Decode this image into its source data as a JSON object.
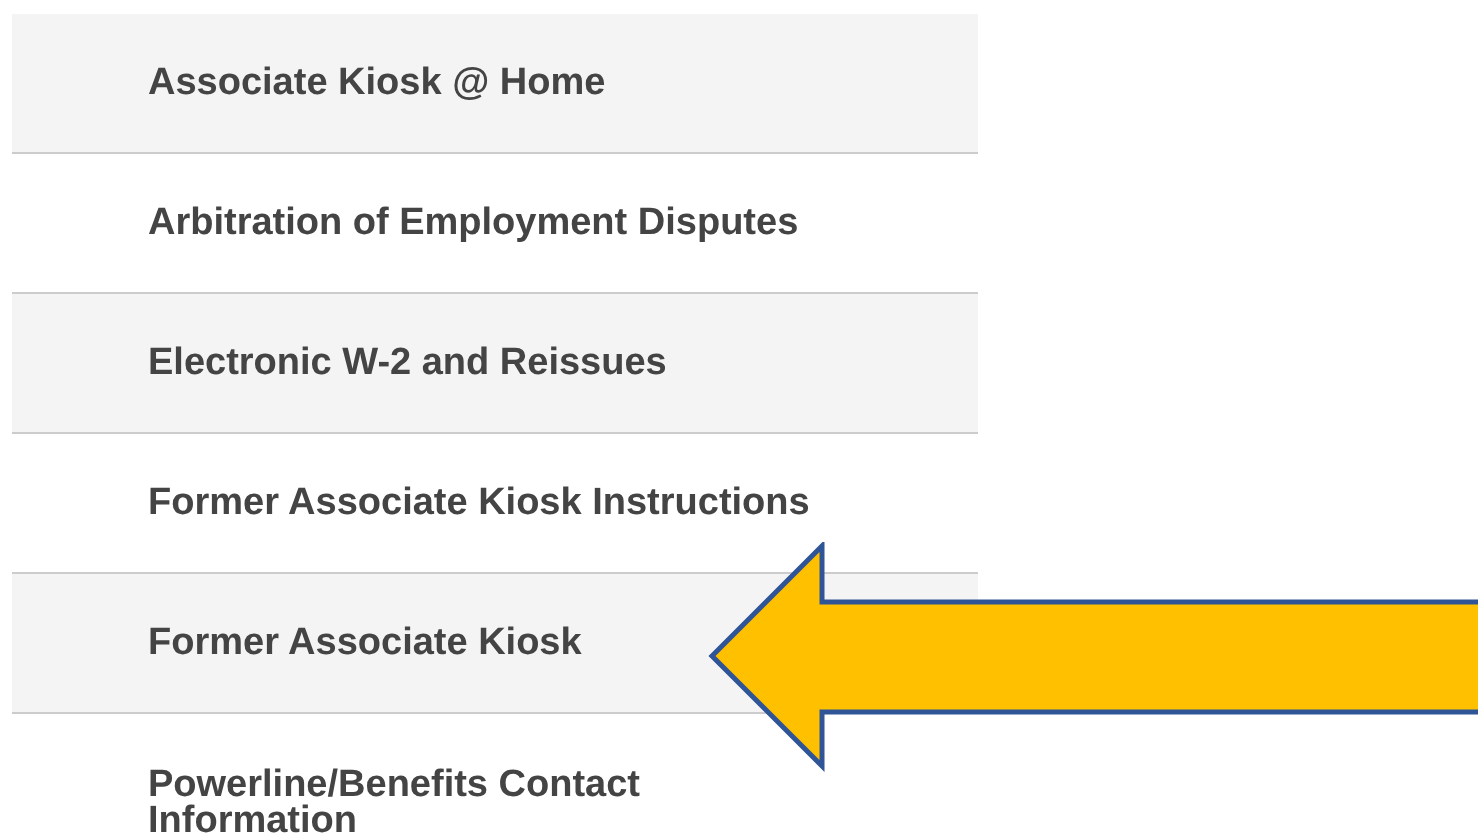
{
  "menu": {
    "items": [
      {
        "label": "Associate Kiosk @ Home"
      },
      {
        "label": "Arbitration of Employment Disputes"
      },
      {
        "label": "Electronic W-2 and Reissues"
      },
      {
        "label": "Former Associate Kiosk Instructions"
      },
      {
        "label": "Former Associate Kiosk"
      },
      {
        "label": "Powerline/Benefits Contact Information"
      }
    ]
  }
}
